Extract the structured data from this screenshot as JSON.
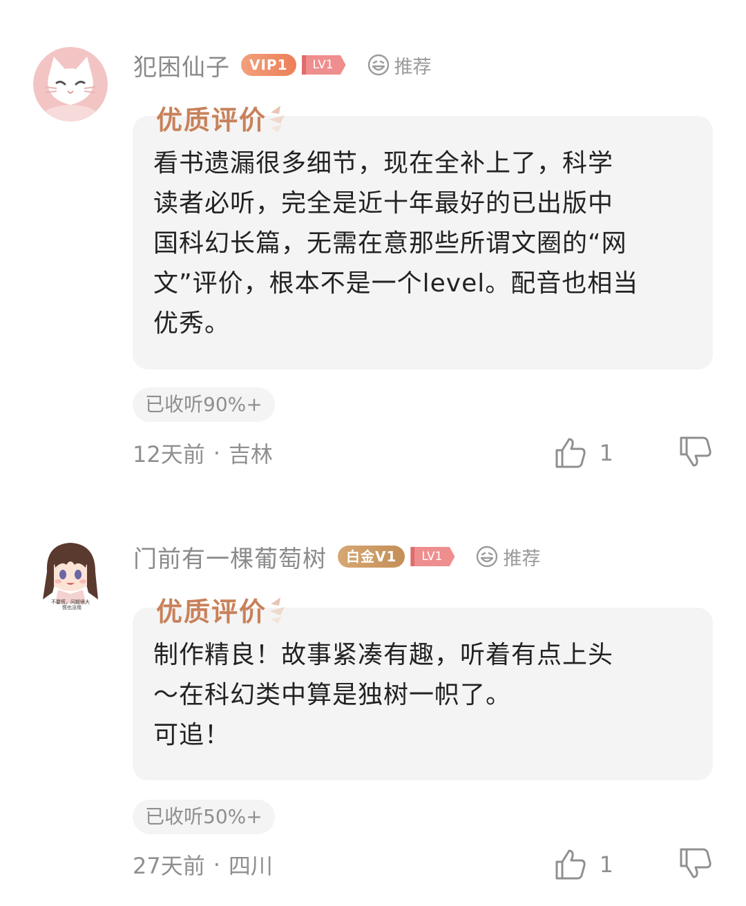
{
  "comments": [
    {
      "username": "犯困仙子",
      "vip_badge": "VIP1",
      "level_badge": "LV1",
      "recommend_label": "推荐",
      "quality_label": "优质评价",
      "text": "看书遗漏很多细节，现在全补上了，科学\n读者必听，完全是近十年最好的已出版中\n国科幻长篇，无需在意那些所谓文圈的“网\n文”评价，根本不是一个level。配音也相当\n优秀。",
      "listen_progress": "已收听90%+",
      "time": "12天前",
      "location": "吉林",
      "like_count": "1",
      "colors": {
        "vip": "#ec7f58",
        "avatar_bg": "#f3c4c4"
      },
      "avatar_icon": "white-cat-avatar-icon"
    },
    {
      "username": "门前有一棵葡萄树",
      "vip_badge": "白金V1",
      "level_badge": "LV1",
      "recommend_label": "推荐",
      "quality_label": "优质评价",
      "text": "制作精良！故事紧凑有趣，听着有点上头\n～在科幻类中算是独树一帜了。\n可追！",
      "listen_progress": "已收听50%+",
      "time": "27天前",
      "location": "四川",
      "like_count": "1",
      "avatar_caption_1": "不要慌，问题很大",
      "avatar_caption_2": "慌也没用",
      "colors": {
        "vip": "#c48f57"
      },
      "avatar_icon": "anime-girl-avatar-icon"
    }
  ]
}
